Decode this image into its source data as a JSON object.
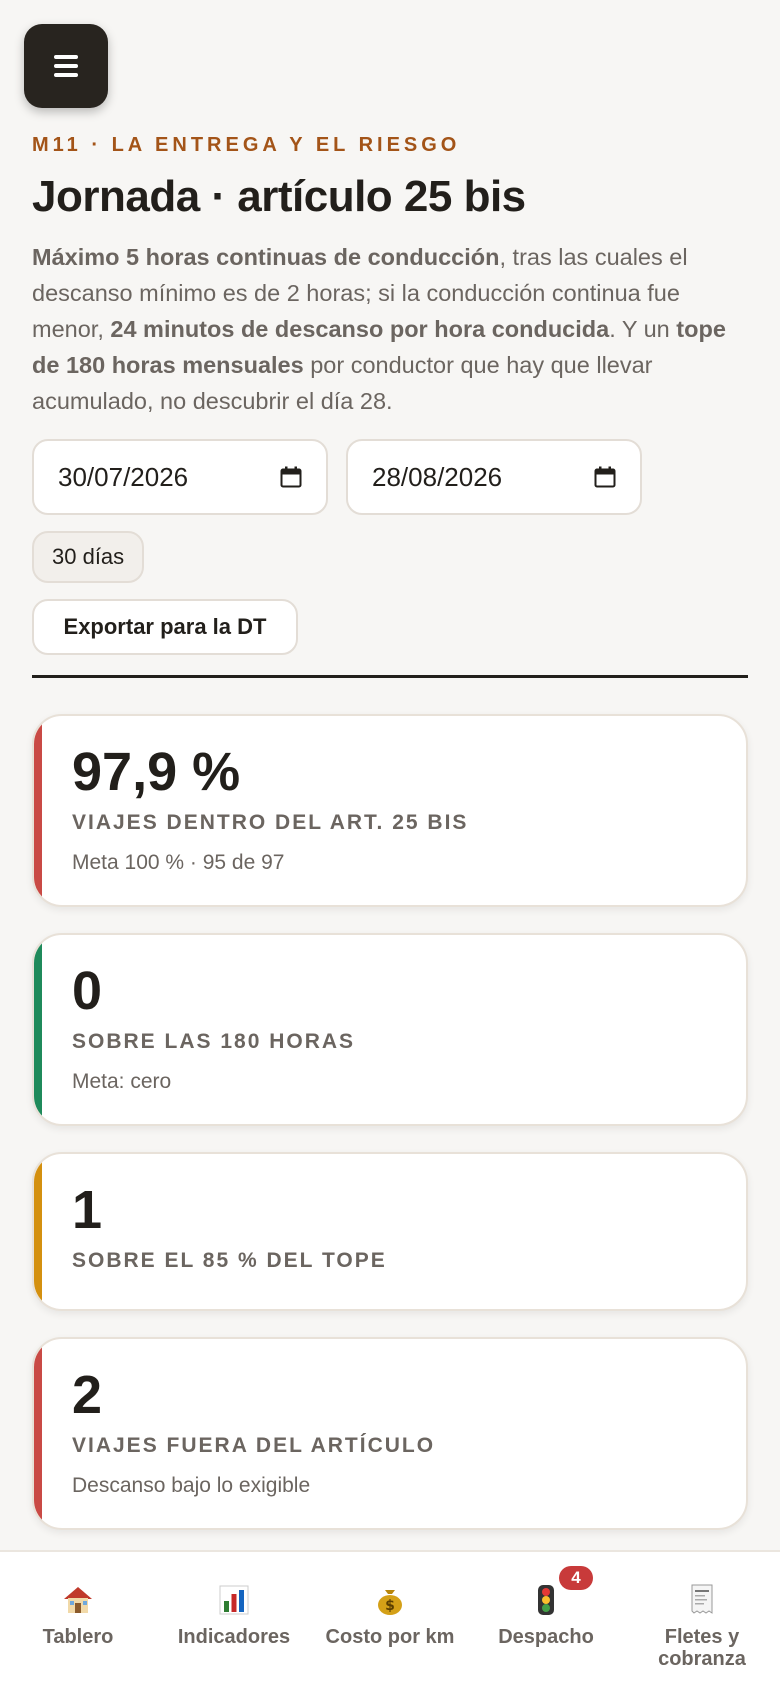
{
  "header": {
    "eyebrow": "M11 · La entrega y el riesgo",
    "title": "Jornada · artículo 25 bis",
    "desc_b1": "Máximo 5 horas continuas de conducción",
    "desc_t1": ", tras las cuales el descanso mínimo es de 2 horas; si la conducción continua fue menor, ",
    "desc_b2": "24 minutos de descanso por hora conducida",
    "desc_t2": ". Y un ",
    "desc_b3": "tope de 180 horas mensuales",
    "desc_t3": " por conductor que hay que llevar acumulado, no descubrir el día 28."
  },
  "filters": {
    "date_from": "30/07/2026",
    "date_to": "28/08/2026",
    "range_label": "30 días",
    "export_label": "Exportar para la DT"
  },
  "cards": [
    {
      "value": "97,9 %",
      "label": "Viajes dentro del art. 25 bis",
      "note": "Meta 100 % · 95 de 97",
      "accent": "#c94a45"
    },
    {
      "value": "0",
      "label": "Sobre las 180 horas",
      "note": "Meta: cero",
      "accent": "#1f8a5b"
    },
    {
      "value": "1",
      "label": "Sobre el 85 % del tope",
      "note": "",
      "accent": "#d4900f"
    },
    {
      "value": "2",
      "label": "Viajes fuera del artículo",
      "note": "Descanso bajo lo exigible",
      "accent": "#c94a45"
    }
  ],
  "nav": {
    "items": [
      {
        "label": "Tablero",
        "icon": "house-icon"
      },
      {
        "label": "Indicadores",
        "icon": "bar-chart-icon"
      },
      {
        "label": "Costo por km",
        "icon": "money-bag-icon"
      },
      {
        "label": "Despacho",
        "icon": "traffic-light-icon",
        "badge": "4"
      },
      {
        "label": "Fletes y cobranza",
        "icon": "receipt-icon"
      }
    ]
  }
}
